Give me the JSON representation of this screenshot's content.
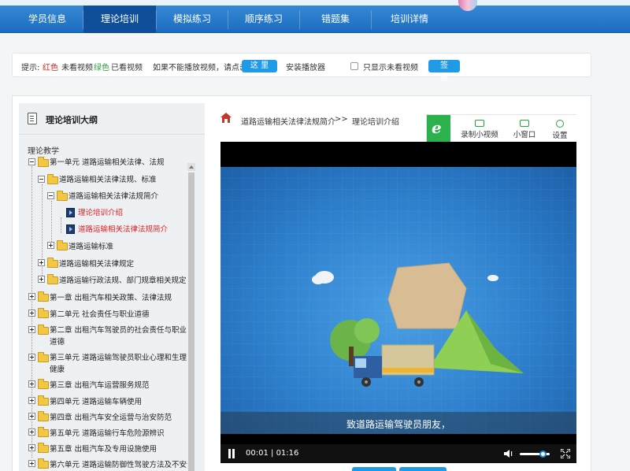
{
  "nav": {
    "items": [
      {
        "label": "学员信息"
      },
      {
        "label": "理论培训"
      },
      {
        "label": "模拟练习"
      },
      {
        "label": "顺序练习"
      },
      {
        "label": "错题集"
      },
      {
        "label": "培训详情"
      }
    ],
    "active_index": 1
  },
  "hint": {
    "prefix": "提示:",
    "red_word": "红色",
    "red_meaning": "未看视频",
    "green_word": "绿色",
    "green_meaning": "已看视频",
    "cannot_play_text": "如果不能播放视频，请点击",
    "here_button": "这 里",
    "install_player": "安装播放器",
    "only_unwatched_label": "只显示未看视频",
    "signout_button": "签 退",
    "colors": {
      "red": "#e02020",
      "green": "#2aa13f"
    }
  },
  "sidebar": {
    "title": "理论培训大纲",
    "subtitle": "理论教学",
    "tree": [
      {
        "label": "第一单元 道路运输相关法律、法规",
        "expanded": true
      },
      {
        "label": "道路运输相关法律法规、标准",
        "expanded": true
      },
      {
        "label": "道路运输相关法律法规简介",
        "expanded": true
      },
      {
        "label": "理论培训介绍",
        "type": "video",
        "status": "red"
      },
      {
        "label": "道路运输相关法律法规简介",
        "type": "video",
        "status": "red"
      },
      {
        "label": "道路运输标准",
        "expanded": false
      },
      {
        "label": "道路运输相关法律规定",
        "expanded": false
      },
      {
        "label": "道路运输行政法规、部门规章相关规定",
        "expanded": false
      },
      {
        "label": "第一章 出租汽车相关政策、法律法规",
        "expanded": false
      },
      {
        "label": "第二单元 社会责任与职业道德",
        "expanded": false
      },
      {
        "label": "第二章 出租汽车驾驶员的社会责任与职业道德",
        "expanded": false
      },
      {
        "label": "第三单元 道路运输驾驶员职业心理和生理健康",
        "expanded": false
      },
      {
        "label": "第三章 出租汽车运营服务规范",
        "expanded": false
      },
      {
        "label": "第四单元 道路运输车辆使用",
        "expanded": false
      },
      {
        "label": "第四章 出租汽车安全运营与治安防范",
        "expanded": false
      },
      {
        "label": "第五单元 道路运输行车危险源辨识",
        "expanded": false
      },
      {
        "label": "第五章 出租汽车及专用设施使用",
        "expanded": false
      },
      {
        "label": "第六单元 道路运输防御性驾驶方法及不安全",
        "expanded": false
      }
    ]
  },
  "breadcrumb": {
    "section": "道路运输相关法律法规简介",
    "separator": ">>",
    "current": "理论培训介绍"
  },
  "tools": {
    "record": "录制小视频",
    "mini_window": "小窗口",
    "settings": "设置"
  },
  "video": {
    "subtitle": "致道路运输驾驶员朋友，",
    "time_current": "00:01",
    "time_total": "01:16",
    "time_sep": " | ",
    "volume_level": 0.85
  }
}
